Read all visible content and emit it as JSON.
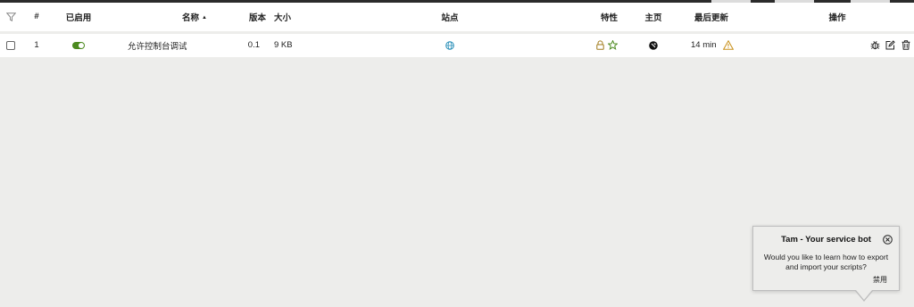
{
  "header": {
    "col_num": "#",
    "col_enabled": "已启用",
    "col_name": "名称",
    "sort_indicator": "▲",
    "col_version": "版本",
    "col_size": "大小",
    "col_sites": "站点",
    "col_features": "特性",
    "col_homepage": "主页",
    "col_updated": "最后更新",
    "col_actions": "操作"
  },
  "scripts": [
    {
      "index": "1",
      "enabled": true,
      "name": "允许控制台调试",
      "version": "0.1",
      "size": "9 KB",
      "updated": "14 min"
    }
  ],
  "colors": {
    "toggle_on": "#4c8a1f",
    "site_globe": "#2a8fb8",
    "feature_icons": "#a07a1a",
    "feature_star": "#4c8a1f",
    "warning": "#c8901a"
  },
  "icons": {
    "filter": "filter-icon",
    "site": "globe-icon",
    "feature_lock": "lock-icon",
    "feature_star": "star-icon",
    "homepage": "homepage-icon",
    "warning": "warning-icon",
    "bug": "bug-icon",
    "edit": "edit-icon",
    "delete": "trash-icon",
    "close": "close-circle-icon"
  },
  "bot": {
    "title": "Tam - Your service bot",
    "message": "Would you like to learn how to export and import your scripts?",
    "dismiss_label": "禁用"
  }
}
